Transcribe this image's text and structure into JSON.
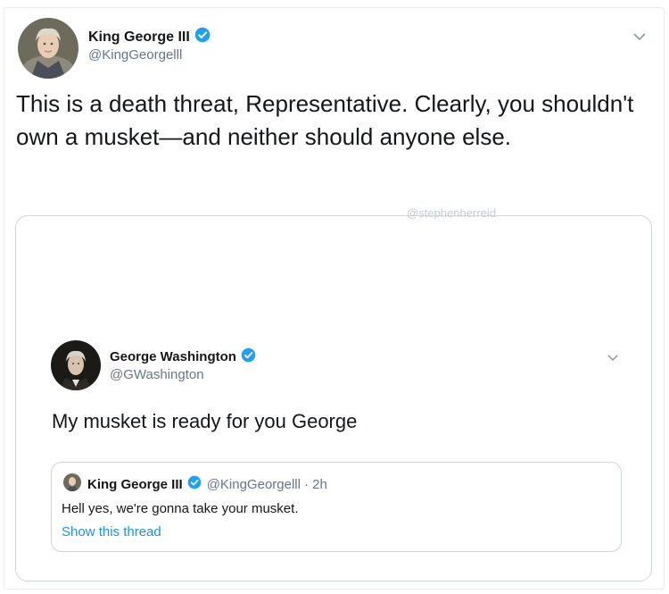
{
  "tweet": {
    "author_name": "King George III",
    "author_handle": "@KingGeorgelll",
    "text": "This is a death threat, Representative. Clearly, you shouldn't own a musket—and neither should anyone else."
  },
  "watermark": "@stephenherreid",
  "embedded_tweet": {
    "author_name": "George Washington",
    "author_handle": "@GWashington",
    "text": "My musket is ready for you George",
    "quoted": {
      "author_name": "King George III",
      "author_handle": "@KingGeorgelll",
      "time": "· 2h",
      "text": "Hell yes, we're gonna take your musket.",
      "thread_link": "Show this thread"
    }
  },
  "colors": {
    "verified": "#1da1f2",
    "link": "#1b95e0",
    "secondary_text": "#657786"
  },
  "icons": [
    "verified-badge-icon",
    "chevron-down-icon",
    "avatar-king-george",
    "avatar-george-washington"
  ]
}
